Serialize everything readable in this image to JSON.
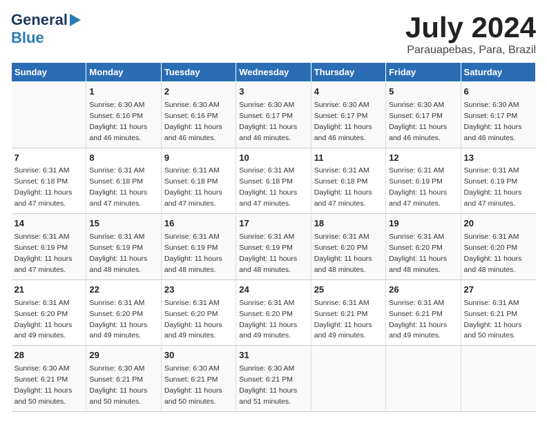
{
  "header": {
    "logo_line1": "General",
    "logo_line2": "Blue",
    "title": "July 2024",
    "subtitle": "Parauapebas, Para, Brazil"
  },
  "calendar": {
    "weekdays": [
      "Sunday",
      "Monday",
      "Tuesday",
      "Wednesday",
      "Thursday",
      "Friday",
      "Saturday"
    ],
    "weeks": [
      [
        {
          "day": "",
          "detail": ""
        },
        {
          "day": "1",
          "detail": "Sunrise: 6:30 AM\nSunset: 6:16 PM\nDaylight: 11 hours\nand 46 minutes."
        },
        {
          "day": "2",
          "detail": "Sunrise: 6:30 AM\nSunset: 6:16 PM\nDaylight: 11 hours\nand 46 minutes."
        },
        {
          "day": "3",
          "detail": "Sunrise: 6:30 AM\nSunset: 6:17 PM\nDaylight: 11 hours\nand 46 minutes."
        },
        {
          "day": "4",
          "detail": "Sunrise: 6:30 AM\nSunset: 6:17 PM\nDaylight: 11 hours\nand 46 minutes."
        },
        {
          "day": "5",
          "detail": "Sunrise: 6:30 AM\nSunset: 6:17 PM\nDaylight: 11 hours\nand 46 minutes."
        },
        {
          "day": "6",
          "detail": "Sunrise: 6:30 AM\nSunset: 6:17 PM\nDaylight: 11 hours\nand 46 minutes."
        }
      ],
      [
        {
          "day": "7",
          "detail": "Sunrise: 6:31 AM\nSunset: 6:18 PM\nDaylight: 11 hours\nand 47 minutes."
        },
        {
          "day": "8",
          "detail": "Sunrise: 6:31 AM\nSunset: 6:18 PM\nDaylight: 11 hours\nand 47 minutes."
        },
        {
          "day": "9",
          "detail": "Sunrise: 6:31 AM\nSunset: 6:18 PM\nDaylight: 11 hours\nand 47 minutes."
        },
        {
          "day": "10",
          "detail": "Sunrise: 6:31 AM\nSunset: 6:18 PM\nDaylight: 11 hours\nand 47 minutes."
        },
        {
          "day": "11",
          "detail": "Sunrise: 6:31 AM\nSunset: 6:18 PM\nDaylight: 11 hours\nand 47 minutes."
        },
        {
          "day": "12",
          "detail": "Sunrise: 6:31 AM\nSunset: 6:19 PM\nDaylight: 11 hours\nand 47 minutes."
        },
        {
          "day": "13",
          "detail": "Sunrise: 6:31 AM\nSunset: 6:19 PM\nDaylight: 11 hours\nand 47 minutes."
        }
      ],
      [
        {
          "day": "14",
          "detail": "Sunrise: 6:31 AM\nSunset: 6:19 PM\nDaylight: 11 hours\nand 47 minutes."
        },
        {
          "day": "15",
          "detail": "Sunrise: 6:31 AM\nSunset: 6:19 PM\nDaylight: 11 hours\nand 48 minutes."
        },
        {
          "day": "16",
          "detail": "Sunrise: 6:31 AM\nSunset: 6:19 PM\nDaylight: 11 hours\nand 48 minutes."
        },
        {
          "day": "17",
          "detail": "Sunrise: 6:31 AM\nSunset: 6:19 PM\nDaylight: 11 hours\nand 48 minutes."
        },
        {
          "day": "18",
          "detail": "Sunrise: 6:31 AM\nSunset: 6:20 PM\nDaylight: 11 hours\nand 48 minutes."
        },
        {
          "day": "19",
          "detail": "Sunrise: 6:31 AM\nSunset: 6:20 PM\nDaylight: 11 hours\nand 48 minutes."
        },
        {
          "day": "20",
          "detail": "Sunrise: 6:31 AM\nSunset: 6:20 PM\nDaylight: 11 hours\nand 48 minutes."
        }
      ],
      [
        {
          "day": "21",
          "detail": "Sunrise: 6:31 AM\nSunset: 6:20 PM\nDaylight: 11 hours\nand 49 minutes."
        },
        {
          "day": "22",
          "detail": "Sunrise: 6:31 AM\nSunset: 6:20 PM\nDaylight: 11 hours\nand 49 minutes."
        },
        {
          "day": "23",
          "detail": "Sunrise: 6:31 AM\nSunset: 6:20 PM\nDaylight: 11 hours\nand 49 minutes."
        },
        {
          "day": "24",
          "detail": "Sunrise: 6:31 AM\nSunset: 6:20 PM\nDaylight: 11 hours\nand 49 minutes."
        },
        {
          "day": "25",
          "detail": "Sunrise: 6:31 AM\nSunset: 6:21 PM\nDaylight: 11 hours\nand 49 minutes."
        },
        {
          "day": "26",
          "detail": "Sunrise: 6:31 AM\nSunset: 6:21 PM\nDaylight: 11 hours\nand 49 minutes."
        },
        {
          "day": "27",
          "detail": "Sunrise: 6:31 AM\nSunset: 6:21 PM\nDaylight: 11 hours\nand 50 minutes."
        }
      ],
      [
        {
          "day": "28",
          "detail": "Sunrise: 6:30 AM\nSunset: 6:21 PM\nDaylight: 11 hours\nand 50 minutes."
        },
        {
          "day": "29",
          "detail": "Sunrise: 6:30 AM\nSunset: 6:21 PM\nDaylight: 11 hours\nand 50 minutes."
        },
        {
          "day": "30",
          "detail": "Sunrise: 6:30 AM\nSunset: 6:21 PM\nDaylight: 11 hours\nand 50 minutes."
        },
        {
          "day": "31",
          "detail": "Sunrise: 6:30 AM\nSunset: 6:21 PM\nDaylight: 11 hours\nand 51 minutes."
        },
        {
          "day": "",
          "detail": ""
        },
        {
          "day": "",
          "detail": ""
        },
        {
          "day": "",
          "detail": ""
        }
      ]
    ]
  }
}
